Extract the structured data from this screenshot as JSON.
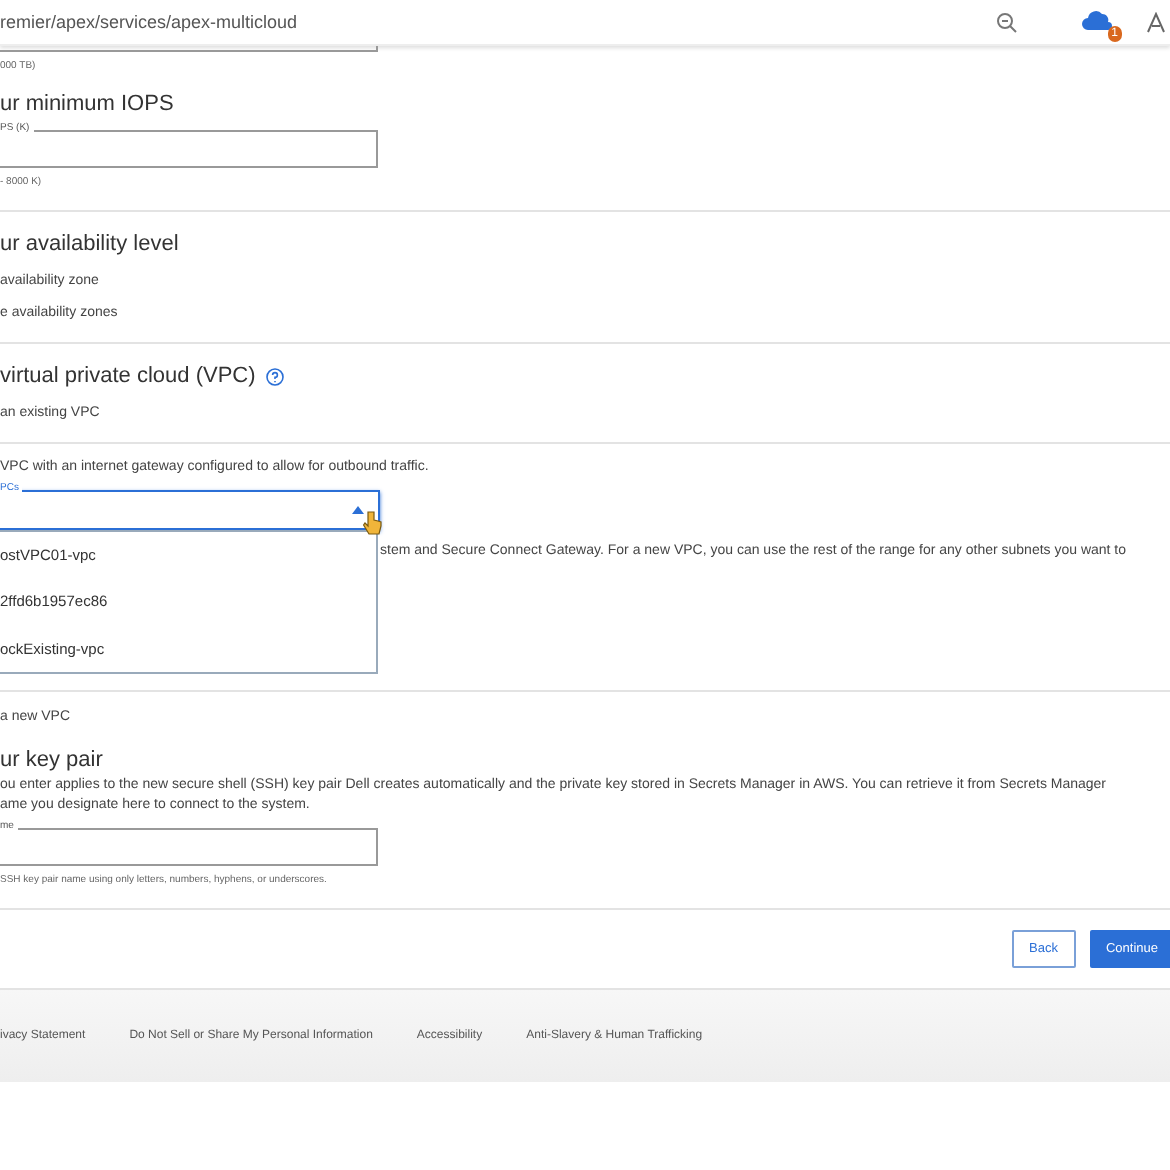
{
  "address_bar": {
    "url": "remier/apex/services/apex-multicloud",
    "badge": "1"
  },
  "capacity": {
    "helper": "000 TB)"
  },
  "iops": {
    "heading": "ur minimum IOPS",
    "field_label": "PS (K)",
    "helper": "- 8000 K)"
  },
  "availability": {
    "heading": "ur availability level",
    "options": [
      "availability zone",
      "e availability zones"
    ]
  },
  "vpc": {
    "heading": "virtual private cloud (VPC)",
    "option": "an existing VPC",
    "note": "VPC with an internet gateway configured to allow for outbound traffic.",
    "select_label": "PCs",
    "expanded": true,
    "menu_items": [
      "ostVPC01-vpc",
      "2ffd6b1957ec86",
      "ockExisting-vpc"
    ],
    "hidden_text": "stem and Secure Connect Gateway. For a new VPC, you can use the rest of the range for any other subnets you want to",
    "new_option": "a new VPC"
  },
  "key_pair": {
    "heading": "ur key pair",
    "paragraph": "ou enter applies to the new secure shell (SSH) key pair Dell creates automatically and the private key stored in Secrets Manager in AWS. You can retrieve it from Secrets Manager",
    "paragraph_2": "ame you designate here to connect to the system.",
    "field_label": "me",
    "helper": "SSH key pair name using only letters, numbers, hyphens, or underscores."
  },
  "buttons": [
    "Back",
    "Continue"
  ],
  "footer_links": [
    "ivacy Statement",
    "Do Not Sell or Share My Personal Information",
    "Accessibility",
    "Anti-Slavery & Human Trafficking"
  ]
}
